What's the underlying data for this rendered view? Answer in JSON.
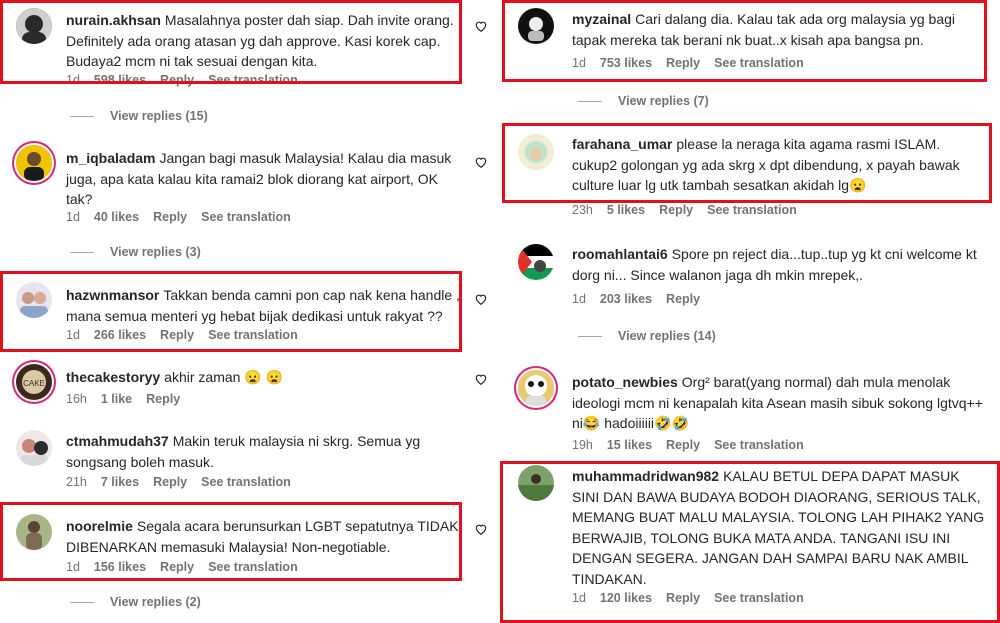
{
  "left": {
    "c1": {
      "user": "nurain.akhsan",
      "text": "Masalahnya poster dah siap. Dah invite orang. Definitely ada orang atasan yg dah approve. Kasi korek cap. Budaya2 mcm ni tak sesuai dengan kita.",
      "time": "1d",
      "likes": "598 likes",
      "reply": "Reply",
      "translate": "See translation"
    },
    "vr1": "View replies (15)",
    "c2": {
      "user": "m_iqbaladam",
      "text": "Jangan bagi masuk Malaysia! Kalau dia masuk juga, apa kata kalau kita ramai2 blok diorang kat airport, OK tak?",
      "time": "1d",
      "likes": "40 likes",
      "reply": "Reply",
      "translate": "See translation"
    },
    "vr2": "View replies (3)",
    "c3": {
      "user": "hazwnmansor",
      "text": "Takkan benda camni pon cap nak kena handle , mana semua menteri yg hebat bijak dedikasi untuk rakyat ??",
      "time": "1d",
      "likes": "266 likes",
      "reply": "Reply",
      "translate": "See translation"
    },
    "c4": {
      "user": "thecakestoryy",
      "text": "akhir zaman",
      "emoji": "😦 😦",
      "time": "16h",
      "likes": "1 like",
      "reply": "Reply"
    },
    "c5": {
      "user": "ctmahmudah37",
      "text": "Makin teruk malaysia ni skrg. Semua yg songsang boleh masuk.",
      "time": "21h",
      "likes": "7 likes",
      "reply": "Reply",
      "translate": "See translation"
    },
    "c6": {
      "user": "noorelmie",
      "text": "Segala acara berunsurkan LGBT sepatutnya TIDAK DIBENARKAN memasuki Malaysia! Non-negotiable.",
      "time": "1d",
      "likes": "156 likes",
      "reply": "Reply",
      "translate": "See translation"
    },
    "vr3": "View replies (2)"
  },
  "right": {
    "c1": {
      "user": "myzainal",
      "text": "Cari dalang dia. Kalau tak ada org malaysia yg bagi tapak mereka tak berani nk buat..x kisah apa bangsa pn.",
      "time": "1d",
      "likes": "753 likes",
      "reply": "Reply",
      "translate": "See translation"
    },
    "vr1": "View replies (7)",
    "c2": {
      "user": "farahana_umar",
      "text": "please la neraga kita agama rasmi ISLAM. cukup2 golongan yg ada skrg x dpt dibendung, x payah bawak culture luar lg utk tambah sesatkan akidah lg",
      "emoji": "😦",
      "time": "23h",
      "likes": "5 likes",
      "reply": "Reply",
      "translate": "See translation"
    },
    "c3": {
      "user": "roomahlantai6",
      "text": "Spore pn reject dia...tup..tup yg kt cni welcome kt dorg ni... Since walanon jaga dh mkin mrepek,.",
      "time": "1d",
      "likes": "203 likes",
      "reply": "Reply"
    },
    "vr2": "View replies (14)",
    "c4": {
      "user": "potato_newbies",
      "text": "Org² barat(yang normal) dah mula menolak ideologi mcm ni kenapalah kita Asean masih sibuk sokong lgtvq++ ni",
      "emoji1": "😂",
      "mid": " hadoiiiiii",
      "emoji2": "🤣🤣",
      "time": "19h",
      "likes": "15 likes",
      "reply": "Reply",
      "translate": "See translation"
    },
    "c5": {
      "user": "muhammadridwan982",
      "text": "KALAU BETUL DEPA DAPAT MASUK SINI DAN BAWA BUDAYA BODOH DIAORANG, SERIOUS TALK, MEMANG BUAT MALU MALAYSIA. TOLONG LAH PIHAK2 YANG BERWAJIB, TOLONG BUKA MATA ANDA. TANGANI ISU INI DENGAN SEGERA. JANGAN DAH SAMPAI BARU NAK AMBIL TINDAKAN.",
      "time": "1d",
      "likes": "120 likes",
      "reply": "Reply",
      "translate": "See translation"
    }
  },
  "colors": {
    "highlight": "#e0101f",
    "meta": "#737373",
    "text": "#262626",
    "story_ring": "#d62976"
  }
}
